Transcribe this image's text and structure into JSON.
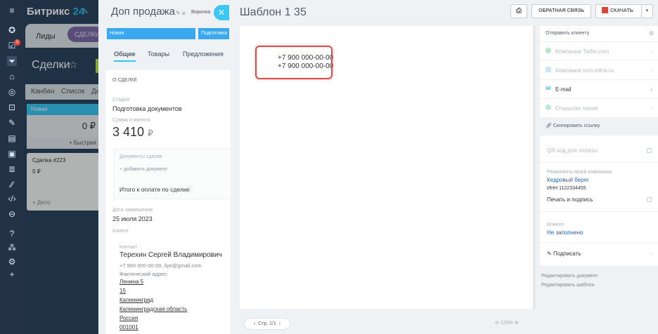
{
  "app": {
    "logo_text": "Битрикс",
    "logo_num": "24"
  },
  "rail": {
    "badge": "1"
  },
  "crm": {
    "tab_leads": "Лиды",
    "tab_deals": "СДЕЛКИ",
    "title": "Сделки",
    "views": [
      "Канбан",
      "Список",
      "Де"
    ],
    "column_name": "Новая",
    "column_sum": "0 ₽",
    "quick_add": "+ Быстрая",
    "card_title": "Сделка #223",
    "card_price": "0 ₽",
    "card_action": "+ Дело"
  },
  "deal": {
    "title": "Доп продажа",
    "funnel": "Воронка",
    "stages": [
      "Новая",
      "Подготовка"
    ],
    "tabs": [
      "Общие",
      "Товары",
      "Предложения"
    ],
    "section": "О СДЕЛКЕ",
    "stage_label": "Стадия",
    "stage_value": "Подготовка документов",
    "amount_label": "Сумма и валюта",
    "amount": "3 410",
    "currency": "₽",
    "docs_label": "Документы сделки",
    "docs_add": "+ добавить документ",
    "total_label": "Итого к оплате по сделке",
    "close_date_label": "Дата завершения",
    "close_date": "25 июля 2023",
    "client_label": "Клиент",
    "contact_label": "Контакт",
    "contact_name": "Терехин Сергей Владимирович",
    "contact_info": "+7 900 000-00-00, ilye@gmail.com",
    "address_label": "Фактический адрес:",
    "address": [
      "Ленина 5",
      "15",
      "Калининград",
      "Калининградская область",
      "Россия",
      "001001"
    ]
  },
  "template": {
    "title": "Шаблон 1 35",
    "feedback_btn": "ОБРАТНАЯ СВЯЗЬ",
    "download_btn": "СКАЧАТЬ",
    "phones": [
      "+7 900 000-00-00",
      "+7 900 000-00-00"
    ],
    "page": "Стр. 1/1",
    "zoom": "120%"
  },
  "side": {
    "send_label": "Отправить клиенту",
    "channels": [
      {
        "label": "Компания Twilio.com",
        "enabled": false,
        "color": "#6fcf7a"
      },
      {
        "label": "Компания sms.edna.ru",
        "enabled": false,
        "color": "#9ad3e8"
      },
      {
        "label": "E-mail",
        "enabled": true,
        "color": "#2fa4d6"
      },
      {
        "label": "Открытая линия",
        "enabled": false,
        "color": "#7fd7b2"
      }
    ],
    "copy_link": "Скопировать ссылку",
    "qr_label": "QR код для оплаты",
    "company_label": "Реквизиты моей компании",
    "company_name": "Кедровый берег",
    "inn": "ИНН 1122334455",
    "print_sign": "Печать и подпись",
    "client_label": "Клиент",
    "client_value": "Не заполнено",
    "sign": "Подписать",
    "edit_doc": "Редактировать документ",
    "edit_tpl": "Редактировать шаблон"
  }
}
